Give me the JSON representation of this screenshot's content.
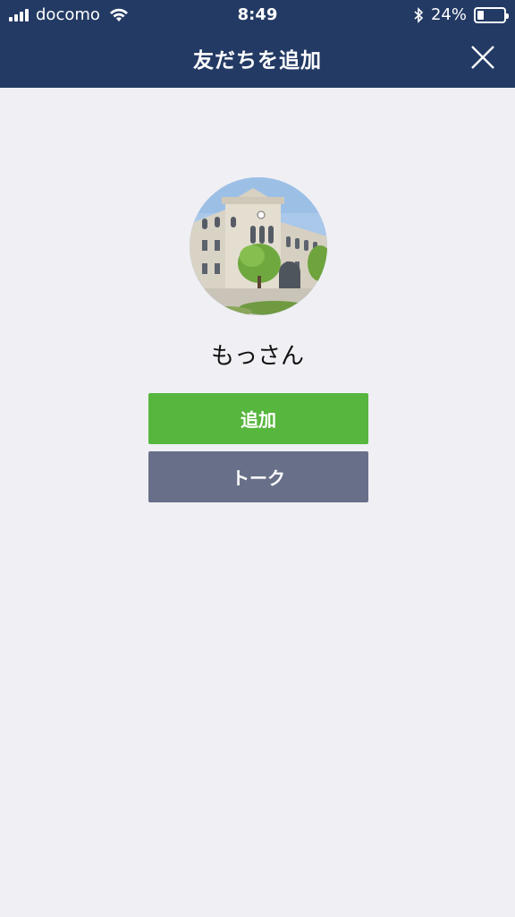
{
  "status_bar": {
    "carrier": "docomo",
    "time": "8:49",
    "battery_percent": "24%",
    "battery_level": 0.24
  },
  "header": {
    "title": "友だちを追加",
    "close_icon": "close-icon"
  },
  "profile": {
    "name": "もっさん",
    "avatar": "university-building-photo"
  },
  "actions": {
    "add_label": "追加",
    "talk_label": "トーク"
  },
  "colors": {
    "header_bg": "#233a64",
    "page_bg": "#efeff4",
    "add_button": "#57b63d",
    "talk_button": "#687089"
  }
}
